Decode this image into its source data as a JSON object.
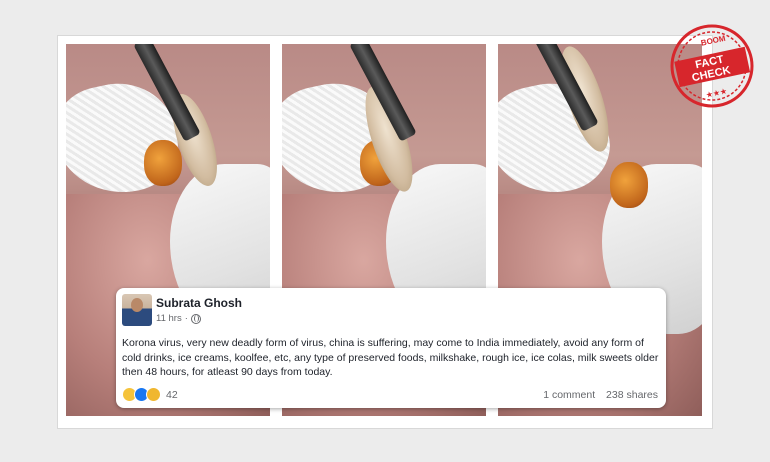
{
  "post": {
    "author": "Subrata Ghosh",
    "time": "11 hrs",
    "separator": "·",
    "message": "Korona virus, very new deadly form of virus, china is suffering, may come to India immediately, avoid any form of cold drinks, ice creams, koolfee, etc, any type of preserved foods, milkshake, rough ice, ice colas, milk sweets older then 48 hours, for atleast 90 days from today.",
    "reaction_count": "42",
    "comments": "1 comment",
    "shares": "238 shares",
    "reaction_icons": [
      "sad-icon",
      "like-icon",
      "wow-icon"
    ]
  },
  "badge": {
    "brand": "BOOM",
    "line1": "FACT",
    "line2": "CHECK",
    "stars": "★★★",
    "color": "#d7262c"
  },
  "colors": {
    "facebook_blue": "#1877f2",
    "text": "#1d2129",
    "muted": "#65676b"
  }
}
